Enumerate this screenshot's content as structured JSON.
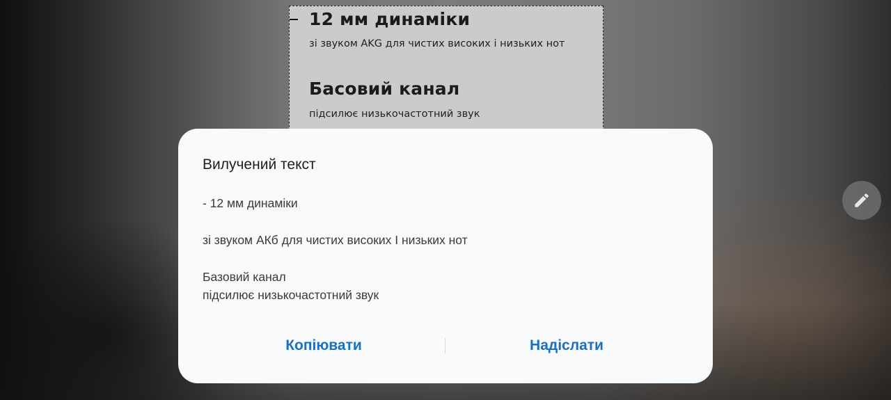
{
  "background_selection": {
    "heading_1": "12 мм динаміки",
    "subtext_1": "зі звуком AKG для чистих високих і низьких нот",
    "heading_2": "Басовий канал",
    "subtext_2": "підсилює низькочастотний звук"
  },
  "edit_button": {
    "icon": "pencil-icon"
  },
  "dialog": {
    "title": "Вилучений текст",
    "paragraphs": [
      "- 12 мм динаміки",
      "зі звуком АКб для чистих високих І низьких нот",
      "Базовий канал",
      "підсилює низькочастотний звук"
    ],
    "actions": {
      "copy_label": "Копіювати",
      "send_label": "Надіслати"
    }
  },
  "colors": {
    "accent": "#1a6fc2",
    "dialog_bg": "#f9fafc",
    "selection_bg": "#cbcbcd"
  }
}
